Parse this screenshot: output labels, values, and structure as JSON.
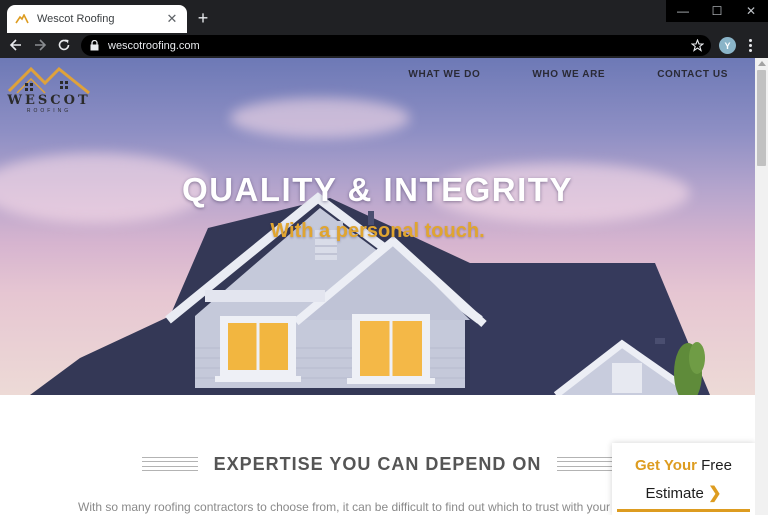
{
  "browser": {
    "tab_title": "Wescot Roofing",
    "tab_close_glyph": "✕",
    "new_tab_glyph": "+",
    "url": "wescotroofing.com",
    "profile_initial": "Y",
    "window_controls": {
      "minimize": "—",
      "maximize": "☐",
      "close": "✕"
    }
  },
  "site": {
    "logo": {
      "word": "WESCOT",
      "sub": "ROOFING"
    },
    "nav": {
      "what_we_do": "WHAT WE DO",
      "who_we_are": "WHO WE ARE",
      "contact_us": "CONTACT US"
    },
    "hero": {
      "title": "QUALITY & INTEGRITY",
      "subtitle": "With a personal touch."
    },
    "section": {
      "heading": "EXPERTISE YOU CAN DEPEND ON",
      "body": "With so many roofing contractors to choose from, it can be difficult to find out which to trust with your roof"
    },
    "cta": {
      "get_your": "Get Your",
      "free": "Free",
      "estimate": "Estimate",
      "arrow": "❯"
    }
  },
  "colors": {
    "accent": "#dd9c20",
    "chrome_dark": "#202124",
    "roof": "#363a5c",
    "siding": "#c7cbdc",
    "heading_text": "#555555"
  },
  "icons": [
    "roof-logo-icon",
    "back-arrow-icon",
    "forward-arrow-icon",
    "reload-icon",
    "lock-icon",
    "star-icon",
    "menu-dots-icon",
    "chevron-right-icon"
  ]
}
